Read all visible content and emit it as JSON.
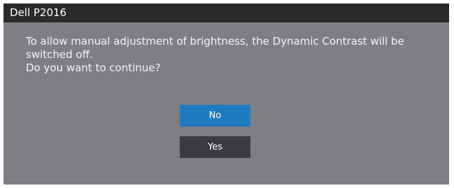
{
  "window": {
    "title": "Dell P2016"
  },
  "dialog": {
    "message_line1": "To allow manual adjustment of brightness, the Dynamic Contrast will be",
    "message_line2": "switched off.",
    "question": "Do you want to continue?"
  },
  "buttons": {
    "no_label": "No",
    "yes_label": "Yes",
    "selected": "No"
  },
  "colors": {
    "title_bar": "#2a2a2c",
    "background": "#7e7f83",
    "selected_button": "#1d7cbf",
    "unselected_button": "#3a3b3e"
  }
}
